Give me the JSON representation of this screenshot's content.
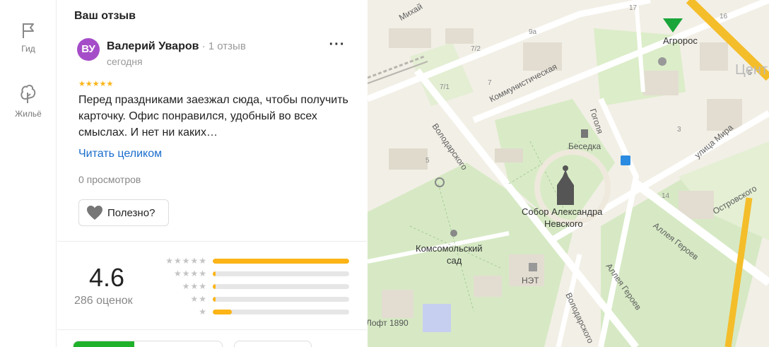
{
  "rail": {
    "guide_label": "Гид",
    "housing_label": "Жильё"
  },
  "review": {
    "section_title": "Ваш отзыв",
    "avatar_initials": "ВУ",
    "author_name": "Валерий Уваров",
    "author_meta": " · 1 отзыв",
    "date": "сегодня",
    "more_label": "···",
    "stars": "★★★★★",
    "text": "Перед праздниками заезжал сюда, чтобы получить карточку. Офис понравился, удобный во всех смыслах. И нет ни каких…",
    "read_more": "Читать целиком",
    "views": "0 просмотров",
    "useful_label": "Полезно?"
  },
  "rating": {
    "value": "4.6",
    "count": "286 оценок",
    "distribution": [
      {
        "stars": "★★★★★",
        "fraction": 1.0
      },
      {
        "stars": "★★★★",
        "fraction": 0.02
      },
      {
        "stars": "★★★",
        "fraction": 0.02
      },
      {
        "stars": "★★",
        "fraction": 0.02
      },
      {
        "stars": "★",
        "fraction": 0.14
      }
    ]
  },
  "map": {
    "labels": {
      "agroros": "Агророс",
      "center": "Цент",
      "kommunisticheskaya": "Коммунистическая",
      "gogolya": "Гоголя",
      "volodarskogo": "Володарского",
      "volodarskogo2": "Володарского",
      "besedka": "Беседка",
      "sobor1": "Собор Александра",
      "sobor2": "Невского",
      "komsomolsky1": "Комсомольский",
      "komsomolsky2": "сад",
      "net": "НЭТ",
      "loft": "Лофт 1890",
      "ulitsa_mira": "улица Мира",
      "ostrovskogo": "Островского",
      "alleya1": "Аллея Героев",
      "alleya2": "Аллея Героев",
      "mikhay": "Михай",
      "n9a": "9а",
      "n72": "7/2",
      "n71": "7/1",
      "n7": "7",
      "n5": "5",
      "n5b": "5",
      "n3": "3",
      "n14": "14",
      "n16": "16",
      "n17": "17"
    }
  },
  "colors": {
    "accent_star": "#fcb416",
    "link": "#1a6dcc",
    "avatar": "#a54dc8",
    "green": "#20b12a"
  }
}
